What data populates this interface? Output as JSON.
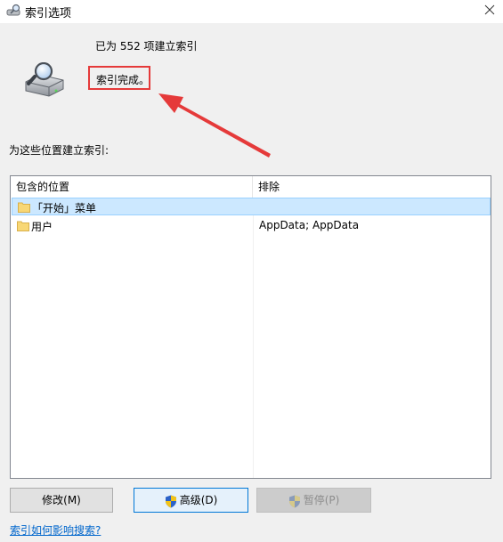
{
  "window": {
    "title": "索引选项",
    "title_icon": "indexing-options-icon",
    "close_icon": "close-icon"
  },
  "status": {
    "indexed_count": "已为 552 项建立索引",
    "indexing_state": "索引完成。",
    "drive_icon": "drive-search-icon",
    "highlight_color": "#e53a3a"
  },
  "locations": {
    "label": "为这些位置建立索引:",
    "columns": [
      "包含的位置",
      "排除"
    ],
    "rows": [
      {
        "location": "「开始」菜单",
        "exclude": "",
        "selected": true,
        "icon": "folder-icon"
      },
      {
        "location": "用户",
        "exclude": "AppData; AppData",
        "selected": false,
        "icon": "folder-icon"
      }
    ]
  },
  "buttons": {
    "modify": "修改(M)",
    "advanced": "高级(D)",
    "pause": "暂停(P)"
  },
  "links": {
    "help": "索引如何影响搜索?"
  },
  "colors": {
    "selection": "#cce8ff",
    "link": "#0066cc",
    "button_focus_border": "#0078d7"
  }
}
